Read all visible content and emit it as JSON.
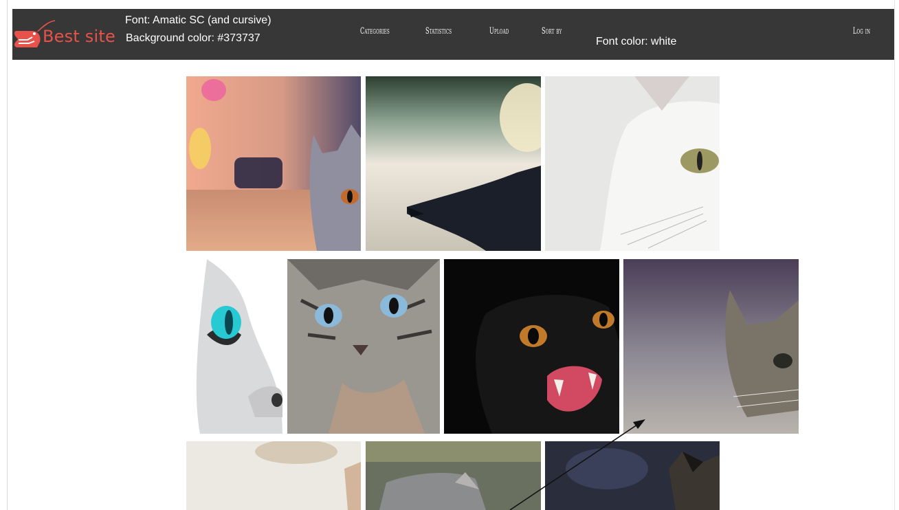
{
  "header": {
    "logo_text": "Best site",
    "note_font": "Font: Amatic SC (and cursive)",
    "note_background": "Background color: #373737",
    "note_font_color": "Font color: white",
    "background_color": "#373737",
    "logo_color": "#e8524a"
  },
  "nav": {
    "categories": "Categories",
    "statistics": "Statistics",
    "upload": "Upload",
    "sort_by": "Sort by",
    "login": "Log in"
  },
  "gallery": {
    "tile_icons": [
      "cat-photo",
      "cat-photo",
      "cat-photo",
      "cat-photo",
      "cat-photo",
      "cat-photo",
      "cat-photo",
      "cat-photo",
      "cat-photo",
      "cat-photo"
    ]
  }
}
